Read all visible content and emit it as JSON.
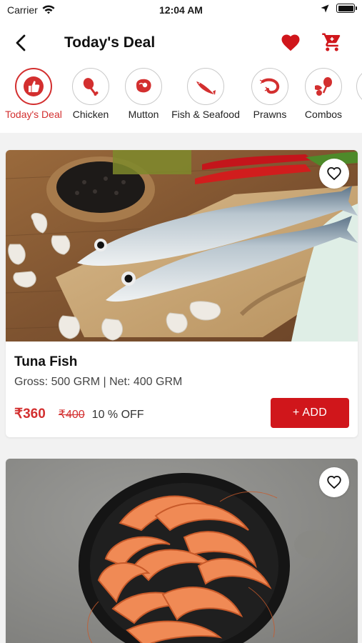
{
  "status_bar": {
    "carrier": "Carrier",
    "time": "12:04 AM"
  },
  "header": {
    "title": "Today's Deal"
  },
  "categories": [
    {
      "label": "Today's Deal",
      "icon": "thumbs-up-icon",
      "active": true
    },
    {
      "label": "Chicken",
      "icon": "chicken-leg-icon",
      "active": false
    },
    {
      "label": "Mutton",
      "icon": "meat-icon",
      "active": false
    },
    {
      "label": "Fish & Seafood",
      "icon": "fish-icon",
      "active": false
    },
    {
      "label": "Prawns",
      "icon": "prawn-icon",
      "active": false
    },
    {
      "label": "Combos",
      "icon": "combo-icon",
      "active": false
    }
  ],
  "products": [
    {
      "name": "Tuna Fish",
      "weight": "Gross: 500 GRM | Net: 400 GRM",
      "price": "₹360",
      "old_price": "₹400",
      "discount": "10 % OFF",
      "add_label": "+ ADD",
      "image": "tuna-fish-photo"
    },
    {
      "image": "prawns-photo"
    }
  ],
  "colors": {
    "accent": "#d32f2f",
    "button": "#d0161b",
    "background": "#f2f2f2"
  }
}
